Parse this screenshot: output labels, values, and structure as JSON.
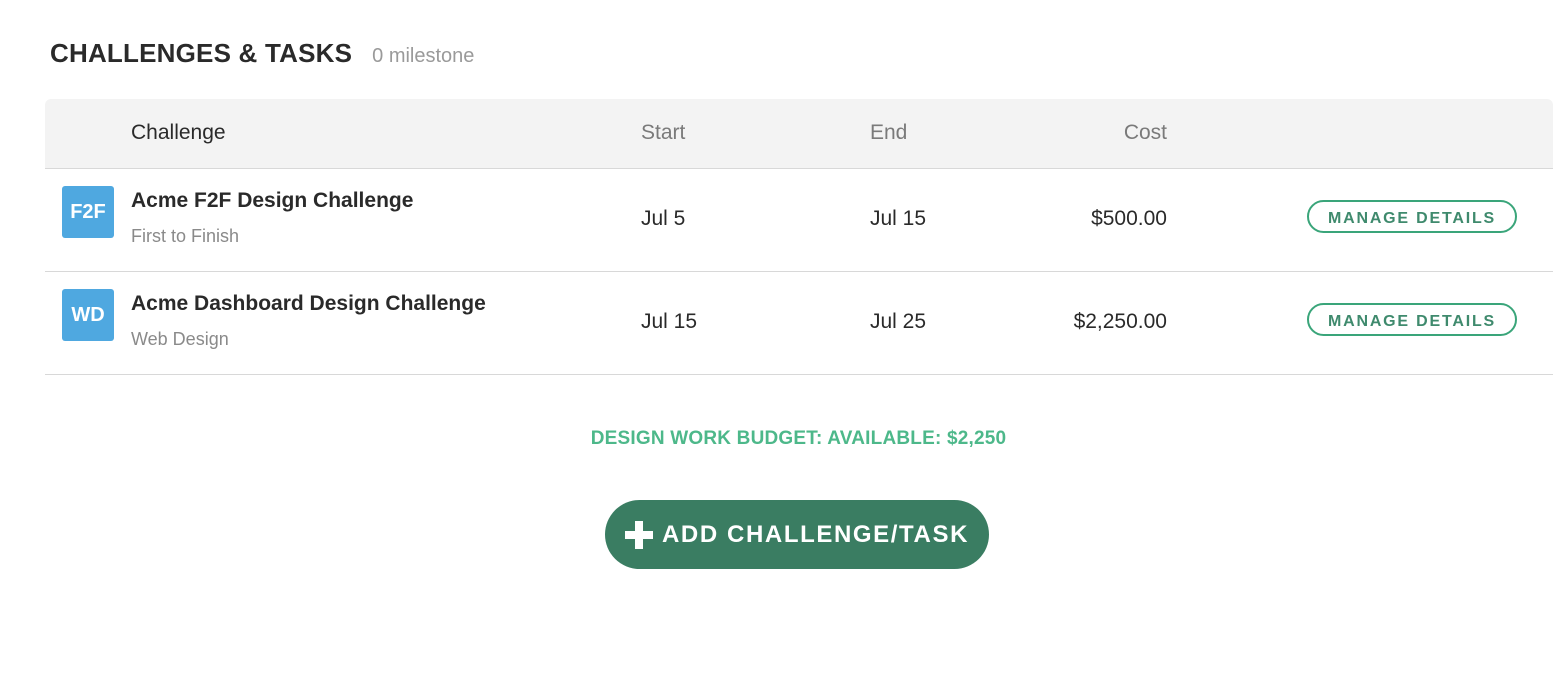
{
  "section": {
    "title": "CHALLENGES & TASKS",
    "subtitle": "0 milestone"
  },
  "table": {
    "headers": {
      "challenge": "Challenge",
      "start": "Start",
      "end": "End",
      "cost": "Cost"
    },
    "rows": [
      {
        "badge": "F2F",
        "name": "Acme F2F Design Challenge",
        "type": "First to Finish",
        "start": "Jul 5",
        "end": "Jul 15",
        "cost": "$500.00",
        "action": "MANAGE DETAILS"
      },
      {
        "badge": "WD",
        "name": "Acme Dashboard Design Challenge",
        "type": "Web Design",
        "start": "Jul 15",
        "end": "Jul 25",
        "cost": "$2,250.00",
        "action": "MANAGE DETAILS"
      }
    ]
  },
  "budget": {
    "text": "DESIGN WORK BUDGET: AVAILABLE: $2,250"
  },
  "add_button": {
    "icon": "plus-icon",
    "label": "ADD CHALLENGE/TASK"
  },
  "colors": {
    "badge": "#4fa8e0",
    "accent_green": "#4db88a",
    "button_green": "#3a7d62",
    "outline_green": "#3aa57a",
    "header_bg": "#f3f3f3"
  }
}
